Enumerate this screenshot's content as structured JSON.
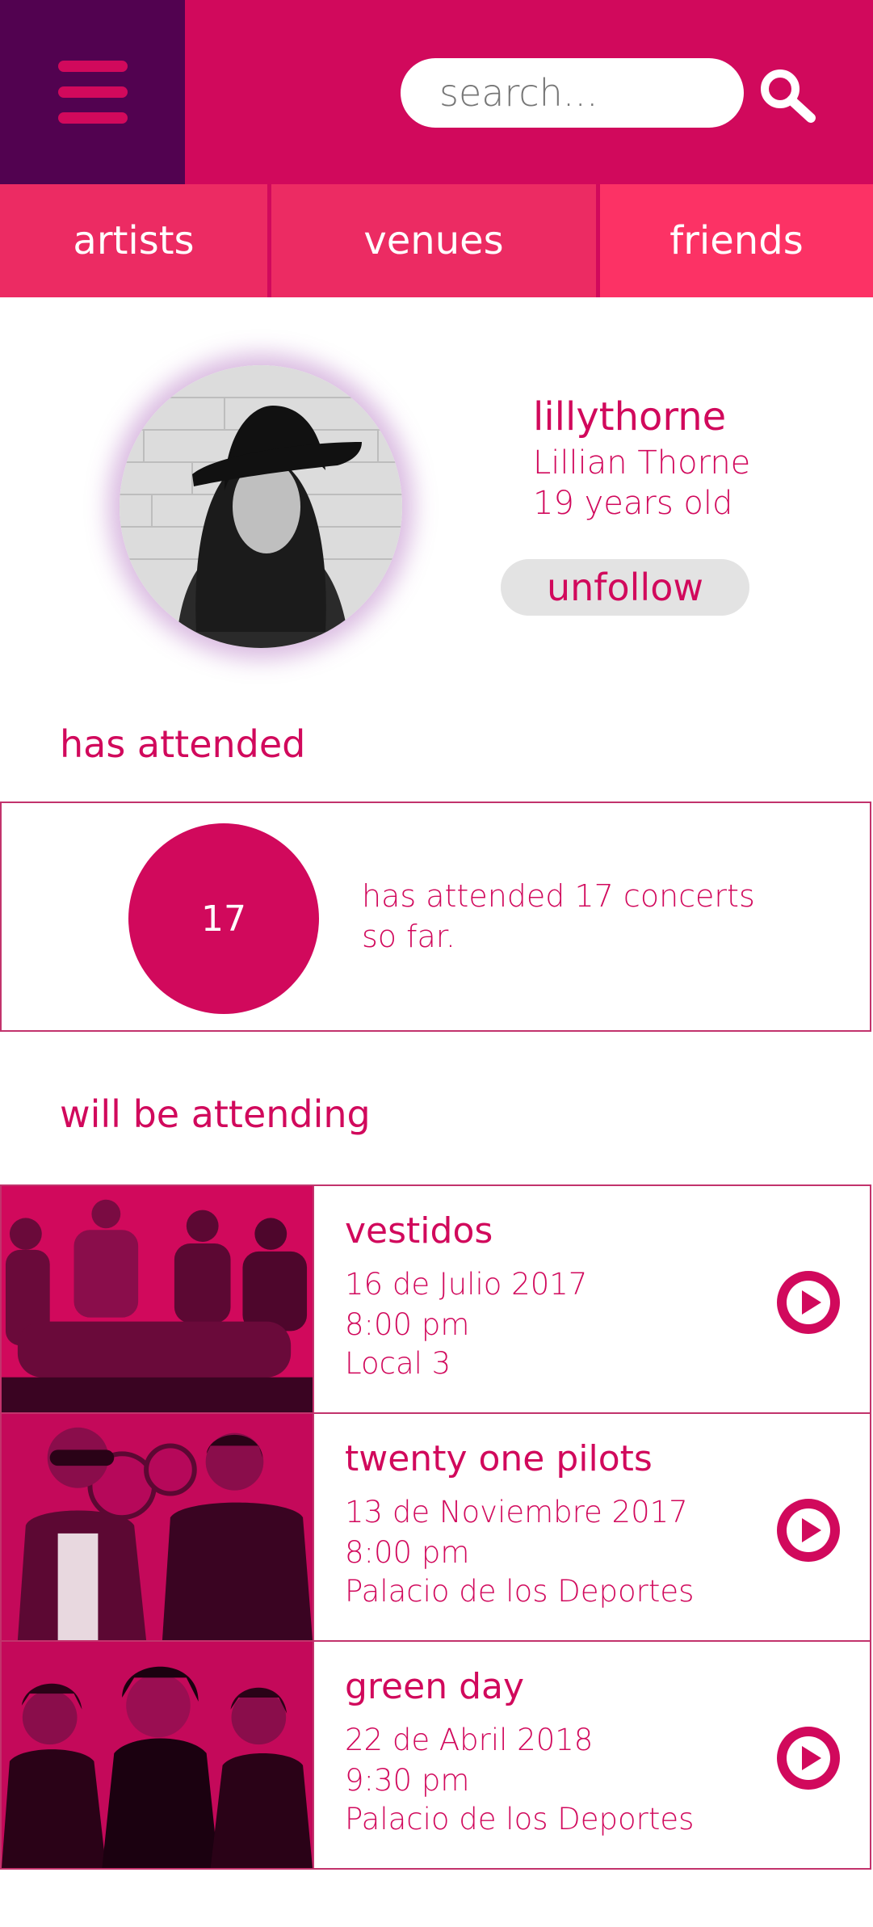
{
  "search": {
    "placeholder": "search..."
  },
  "tabs": [
    {
      "label": "artists"
    },
    {
      "label": "venues"
    },
    {
      "label": "friends"
    }
  ],
  "profile": {
    "username": "lillythorne",
    "full_name": "Lillian Thorne",
    "age": "19 years old",
    "unfollow_label": "unfollow"
  },
  "attended": {
    "heading": "has attended",
    "count": "17",
    "text": "has attended 17 concerts so far."
  },
  "upcoming": {
    "heading": "will be attending",
    "events": [
      {
        "name": "vestidos",
        "date": "16 de Julio 2017",
        "time": "8:00 pm",
        "venue": "Local 3"
      },
      {
        "name": "twenty one pilots",
        "date": "13 de Noviembre 2017",
        "time": "8:00 pm",
        "venue": "Palacio de los Deportes"
      },
      {
        "name": "green day",
        "date": "22 de Abril 2018",
        "time": "9:30 pm",
        "venue": "Palacio de los Deportes"
      }
    ]
  },
  "icons": {
    "menu": "hamburger-menu-icon",
    "search": "search-icon",
    "play": "play-icon"
  },
  "colors": {
    "primary": "#d1095c",
    "menu_bg": "#520250",
    "tab_bg": "#ec2b63",
    "tab_bg_alt": "#fc3265",
    "button_bg": "#e3e3e3"
  }
}
